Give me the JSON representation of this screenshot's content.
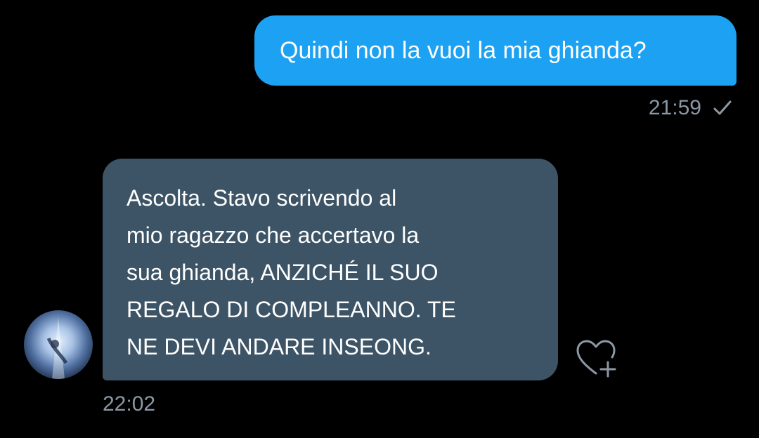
{
  "conversation": {
    "sent_message": {
      "text": "Quindi non la vuoi la mia ghianda?",
      "time": "21:59",
      "status_icon": "check-icon",
      "bubble_color": "#1da1f2"
    },
    "received_message": {
      "text": "Ascolta. Stavo scrivendo al\nmio ragazzo che accertavo la\nsua ghianda, ANZICHÉ IL SUO\nREGALO DI COMPLEANNO. TE\nNE DEVI ANDARE INSEONG.",
      "time": "22:02",
      "bubble_color": "#3d5466",
      "reaction_icon": "heart-plus-icon"
    }
  },
  "theme": {
    "background": "#000000",
    "timestamp_color": "#8b98a5"
  }
}
